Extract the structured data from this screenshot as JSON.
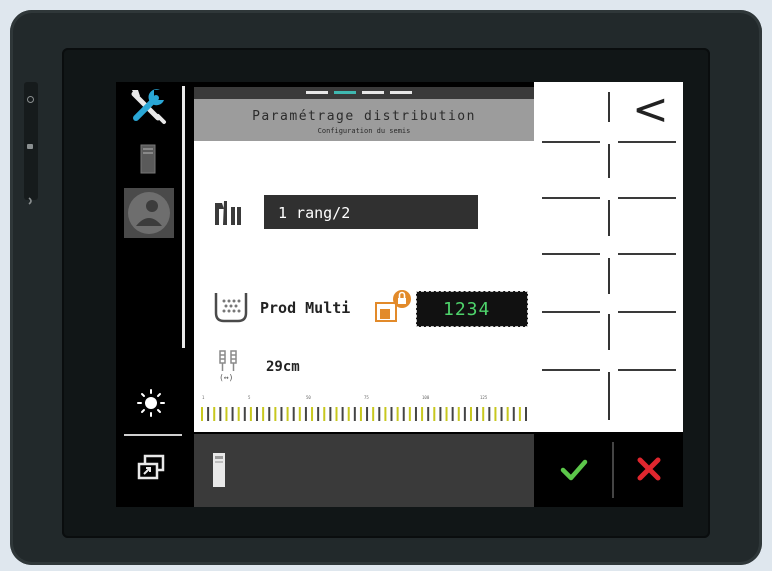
{
  "panel": {
    "title": "Paramétrage distribution",
    "subtitle": "Configuration du semis",
    "active_tab_index": 1
  },
  "row_mode": {
    "value": "1 rang/2"
  },
  "product": {
    "label": "Prod Multi",
    "value": "1234"
  },
  "spacing": {
    "value": "29cm",
    "unit_symbol": "(↔)"
  },
  "scale": {
    "ticks": [
      "1",
      "5",
      "50",
      "75",
      "100",
      "125"
    ]
  },
  "nav": {
    "back_symbol": "<"
  },
  "icons": {
    "settings": "wrench-screwdriver-icon",
    "device": "terminal-icon",
    "profile": "profile-icon",
    "brightness": "sun-icon",
    "window": "window-switch-icon",
    "row": "row-config-icon",
    "hopper": "hopper-icon",
    "lock": "lock-icon",
    "spacing": "row-spacing-icon",
    "confirm": "check-icon",
    "cancel": "cross-icon"
  },
  "colors": {
    "confirm": "#5cc74a",
    "cancel": "#e0262e",
    "active_tab": "#3fb8b0",
    "value_text": "#4ed36b",
    "scale_tick": "#c8c81e"
  }
}
